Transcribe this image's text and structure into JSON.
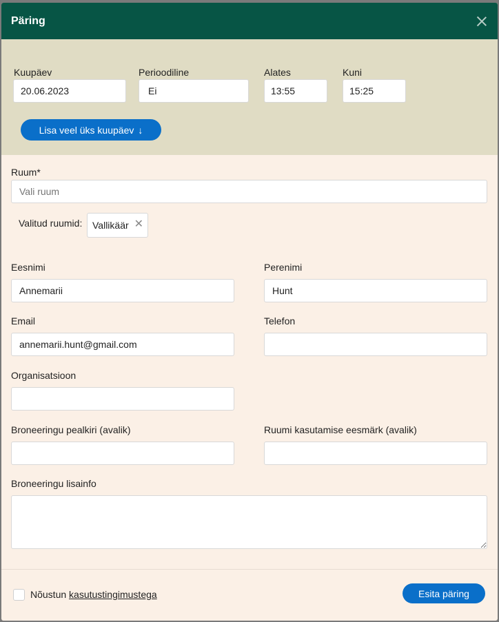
{
  "header": {
    "title": "Päring"
  },
  "date_panel": {
    "date_label": "Kuupäev",
    "date_value": "20.06.2023",
    "periodic_label": "Perioodiline",
    "periodic_value": "Ei",
    "from_label": "Alates",
    "from_value": "13:55",
    "to_label": "Kuni",
    "to_value": "15:25",
    "add_date_label": "Lisa veel üks kuupäev",
    "add_date_arrow": "↓"
  },
  "form": {
    "room_label": "Ruum*",
    "room_placeholder": "Vali ruum",
    "selected_rooms_label": "Valitud ruumid:",
    "selected_rooms": [
      "Vallikäär"
    ],
    "chip_remove": "✕",
    "first_name_label": "Eesnimi",
    "first_name_value": "Annemarii",
    "last_name_label": "Perenimi",
    "last_name_value": "Hunt",
    "email_label": "Email",
    "email_value": "annemarii.hunt@gmail.com",
    "phone_label": "Telefon",
    "phone_value": "",
    "org_label": "Organisatsioon",
    "org_value": "",
    "booking_title_label": "Broneeringu pealkiri (avalik)",
    "booking_title_value": "",
    "purpose_label": "Ruumi kasutamise eesmärk (avalik)",
    "purpose_value": "",
    "extra_info_label": "Broneeringu lisainfo",
    "extra_info_value": ""
  },
  "footer": {
    "consent_prefix": "Nõustun",
    "consent_link": "kasutustingimustega",
    "submit_label": "Esita päring"
  },
  "colors": {
    "header_bg": "#075545",
    "date_panel_bg": "#e0dcc4",
    "form_bg": "#fbf0e6",
    "primary_button": "#0a6fc9"
  }
}
